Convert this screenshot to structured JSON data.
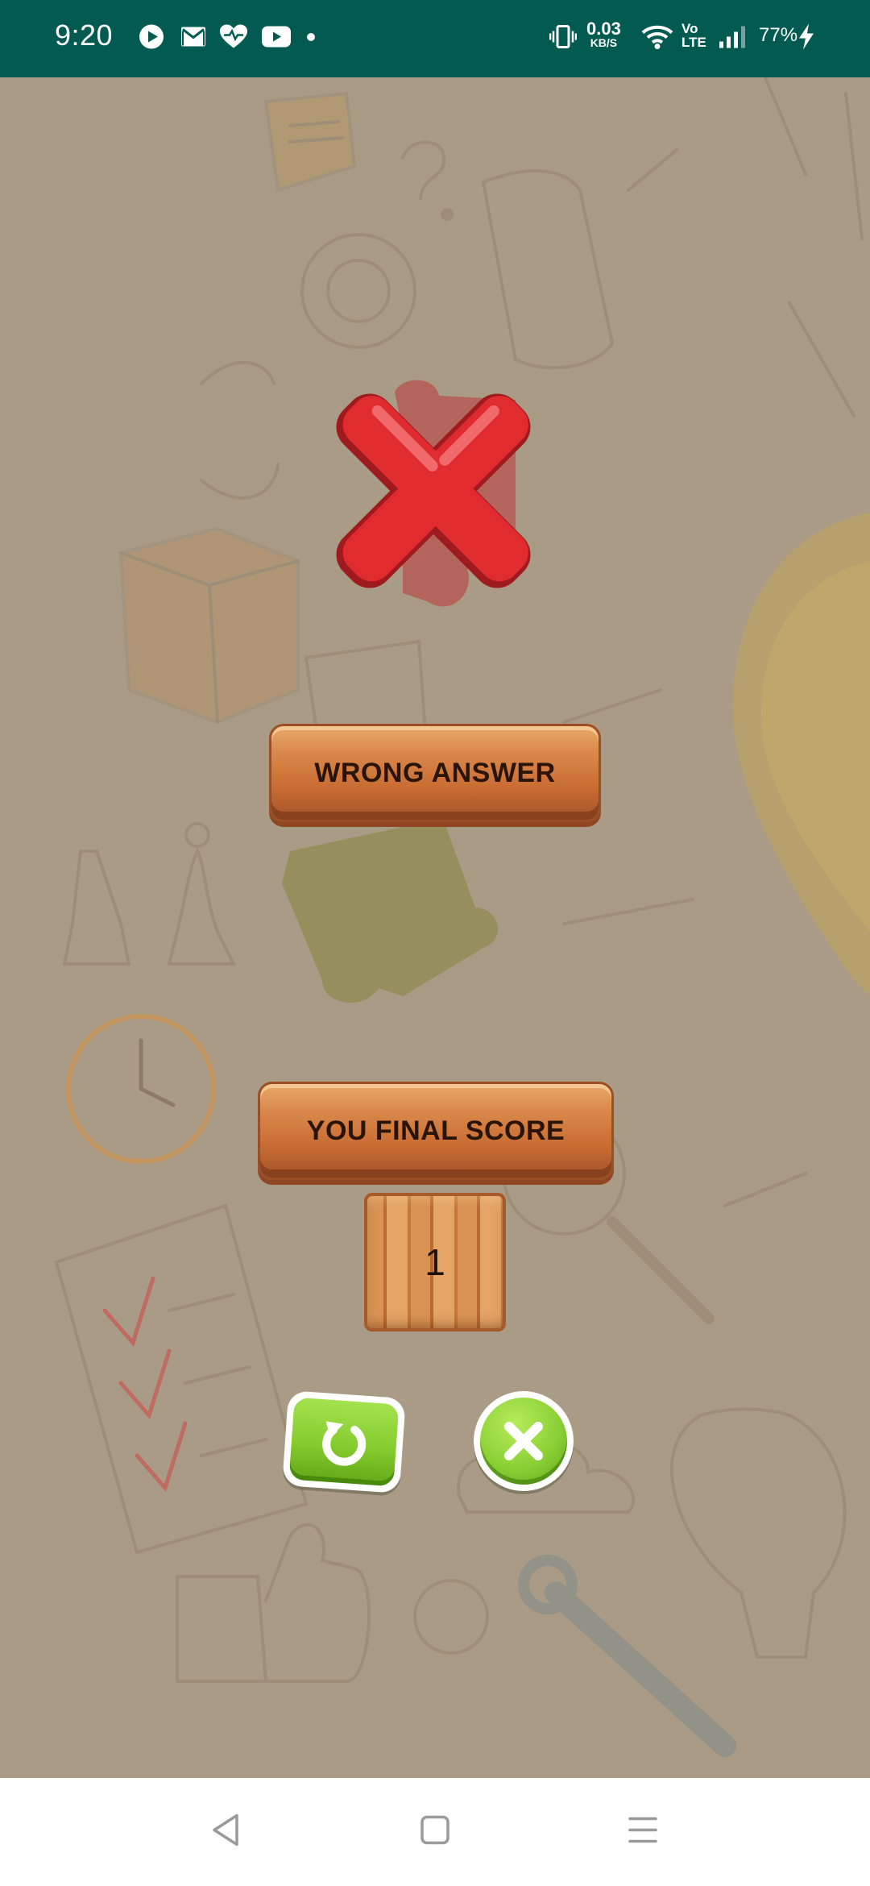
{
  "status_bar": {
    "time": "9:20",
    "notification_icons": [
      "play-circle-icon",
      "gmail-icon",
      "health-heart-icon",
      "youtube-icon",
      "dot-icon"
    ],
    "net_speed_value": "0.03",
    "net_speed_unit": "KB/S",
    "volte_line1": "Vo",
    "volte_line2": "LTE",
    "battery_percent": "77%",
    "system_icons": [
      "vibrate-icon",
      "wifi-icon",
      "signal-icon",
      "charging-icon"
    ]
  },
  "game": {
    "result_icon": "red-x-icon",
    "result_label": "WRONG ANSWER",
    "score_label": "YOU FINAL SCORE",
    "score_value": "1",
    "replay_icon": "replay-icon",
    "close_icon": "close-icon"
  },
  "nav_bar": {
    "icons": [
      "back-triangle-icon",
      "home-square-icon",
      "menu-lines-icon"
    ]
  },
  "colors": {
    "status_bar": "#025a51",
    "background": "#aa9b86",
    "wood": "#c96d33",
    "red_x": "#e02b2f",
    "green_button": "#86cc2e"
  }
}
